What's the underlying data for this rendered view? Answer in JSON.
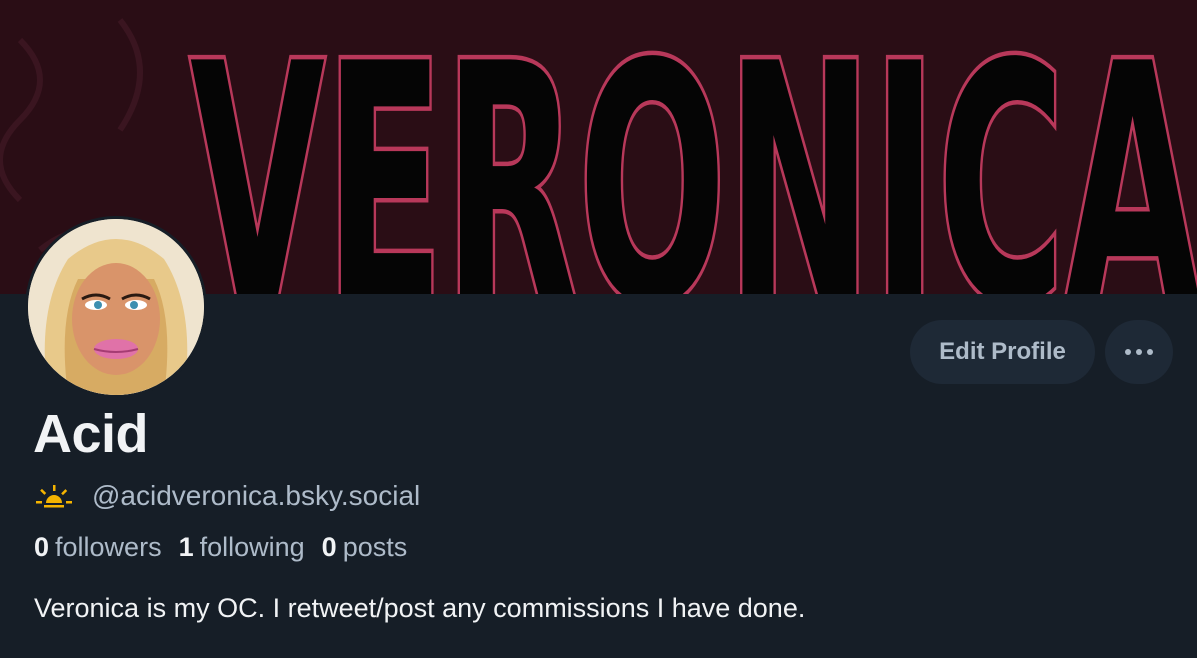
{
  "banner": {
    "text": "VERONICA",
    "colors": {
      "background": "#2a0d15",
      "letter_fill": "#000000",
      "letter_outline": "#b8385a"
    }
  },
  "profile": {
    "display_name": "Acid",
    "handle": "@acidveronica.bsky.social",
    "handle_icon": "sunrise-icon",
    "bio": "Veronica is my OC. I retweet/post any commissions I have done."
  },
  "actions": {
    "edit_label": "Edit Profile",
    "more_icon": "ellipsis-icon"
  },
  "stats": {
    "followers": {
      "count": "0",
      "label": "followers"
    },
    "following": {
      "count": "1",
      "label": "following"
    },
    "posts": {
      "count": "0",
      "label": "posts"
    }
  },
  "colors": {
    "page_bg": "#161e27",
    "button_bg": "#1e2936",
    "muted_text": "#aebbc9",
    "primary_text": "#f1f3f5",
    "sun_yellow": "#f5b400"
  }
}
